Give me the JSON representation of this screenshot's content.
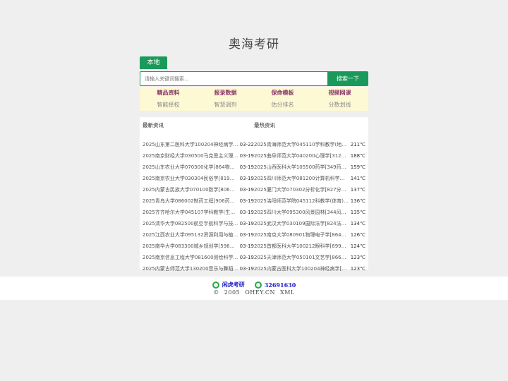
{
  "site": {
    "title": "奥海考研"
  },
  "tabs": {
    "local_label": "本地"
  },
  "search": {
    "placeholder": "请输入关键词搜索...",
    "button_label": "搜索一下"
  },
  "quick_links": {
    "top": [
      "精品资料",
      "报录数据",
      "保命模板",
      "视频网课"
    ],
    "bottom": [
      "智能择校",
      "智慧调剂",
      "估分排名",
      "分数划线"
    ]
  },
  "news": {
    "latest_heading": "最新资讯",
    "hot_heading": "最热资讯",
    "latest": [
      {
        "title": "2025山东第二医科大学100204神经病学[6...",
        "date": "03-22"
      },
      {
        "title": "2025南京财经大学030500马克思主义理...",
        "date": "03-19"
      },
      {
        "title": "2025山东农业大学070300化学[864物理...",
        "date": "03-19"
      },
      {
        "title": "2025南京农业大学030304民俗学[819社...",
        "date": "03-19"
      },
      {
        "title": "2025内蒙古民族大学070100数学[806高...",
        "date": "03-19"
      },
      {
        "title": "2025青岛大学086002制药工程[906药学...",
        "date": "03-19"
      },
      {
        "title": "2025齐齐哈尔大学045107学科教学(生物)...",
        "date": "03-19"
      },
      {
        "title": "2025清华大学082500航空宇航科学与技...",
        "date": "03-19"
      },
      {
        "title": "2025江西农业大学095132资源利用与植...",
        "date": "03-19"
      },
      {
        "title": "2025南华大学083300城乡规划学[596快...",
        "date": "03-19"
      },
      {
        "title": "2025南京信息工程大学081600测绘科学...",
        "date": "03-19"
      },
      {
        "title": "2025内蒙古师范大学130200音乐与舞蹈...",
        "date": "03-19"
      }
    ],
    "hot": [
      {
        "title": "2025青海师范大学045110学科教学(地理)[...",
        "heat": "211℃"
      },
      {
        "title": "2025曲阜师范大学040200心理学[312心...",
        "heat": "188℃"
      },
      {
        "title": "2025山西医科大学105500药学[349药学...",
        "heat": "159℃"
      },
      {
        "title": "2025四川师范大学081200计算机科学与...",
        "heat": "141℃"
      },
      {
        "title": "2025厦门大学070302分析化学[827分析...",
        "heat": "137℃"
      },
      {
        "title": "2025洛阳师范学院045112科教学(体育)[8...",
        "heat": "136℃"
      },
      {
        "title": "2025四川大学095300风景园林[344风景...",
        "heat": "135℃"
      },
      {
        "title": "2025武汉大学030109国际法学[824法学...",
        "heat": "134℃"
      },
      {
        "title": "2025南京大学080901物理电子学[864大...",
        "heat": "126℃"
      },
      {
        "title": "2025首都医科大学100212眼科学[699联...",
        "heat": "124℃"
      },
      {
        "title": "2025天津师范大学050101文艺学[866语...",
        "heat": "123℃"
      },
      {
        "title": "2025内蒙古医科大学100204神经病学[70...",
        "heat": "123℃"
      }
    ]
  },
  "footer": {
    "brand": "闲虎考研",
    "qq": "32691630",
    "copyright_symbol": "©",
    "year": "2005",
    "domain": "OHEY.CN",
    "xml": "XML"
  }
}
